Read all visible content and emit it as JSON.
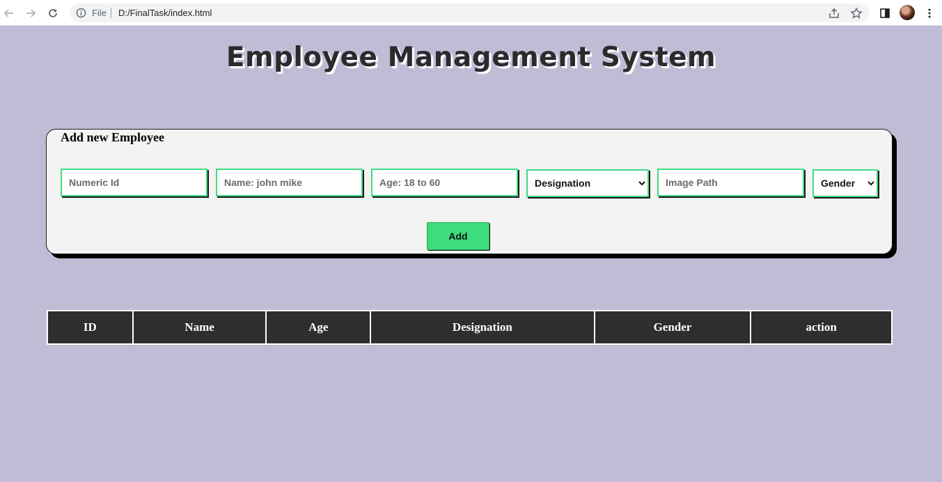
{
  "browser": {
    "scheme_label": "File",
    "url": "D:/FinalTask/index.html"
  },
  "page": {
    "title": "Employee Management System"
  },
  "form": {
    "heading": "Add new Employee",
    "id_placeholder": "Numeric Id",
    "name_placeholder": "Name: john mike",
    "age_placeholder": "Age: 18 to 60",
    "designation_selected": "Designation",
    "image_placeholder": "Image Path",
    "gender_selected": "Gender",
    "add_label": "Add"
  },
  "table": {
    "headers": [
      "ID",
      "Name",
      "Age",
      "Designation",
      "Gender",
      "action"
    ],
    "rows": []
  },
  "colors": {
    "background": "#c1bcd6",
    "accent_green": "#3ddc84",
    "header_dark": "#2e2d30"
  },
  "icons": [
    "back-arrow-icon",
    "forward-arrow-icon",
    "reload-icon",
    "info-icon",
    "share-icon",
    "star-icon",
    "side-panel-icon",
    "avatar",
    "kebab-menu-icon",
    "chevron-down-icon"
  ]
}
